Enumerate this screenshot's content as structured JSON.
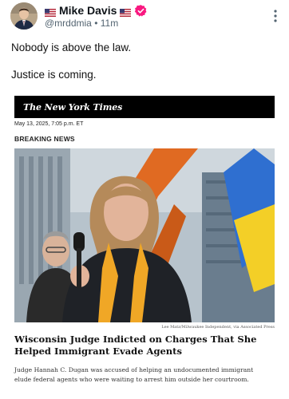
{
  "author": {
    "flag_left": "🇺🇸",
    "display_name": "Mike Davis",
    "flag_right": "🇺🇸",
    "handle": "@mrddmia",
    "separator": "•",
    "time_ago": "11m"
  },
  "post": {
    "lines": [
      "Nobody is above the law.",
      "Justice is coming."
    ]
  },
  "card": {
    "publication": "The New York Times",
    "date": "May 13, 2025, 7:05 p.m. ET",
    "label": "BREAKING NEWS",
    "photo_credit": "Lee Matz/Milwaukee Independent, via Associated Press",
    "headline": "Wisconsin Judge Indicted on Charges That She Helped Immigrant Evade Agents",
    "summary": "Judge Hannah C. Dugan was accused of helping an undocumented immigrant elude federal agents who were waiting to arrest him outside her courtroom."
  },
  "icons": {
    "verified": "verified-badge-icon",
    "more": "more-vertical-icon"
  },
  "colors": {
    "verified": "#f91880",
    "muted_text": "#536471"
  }
}
